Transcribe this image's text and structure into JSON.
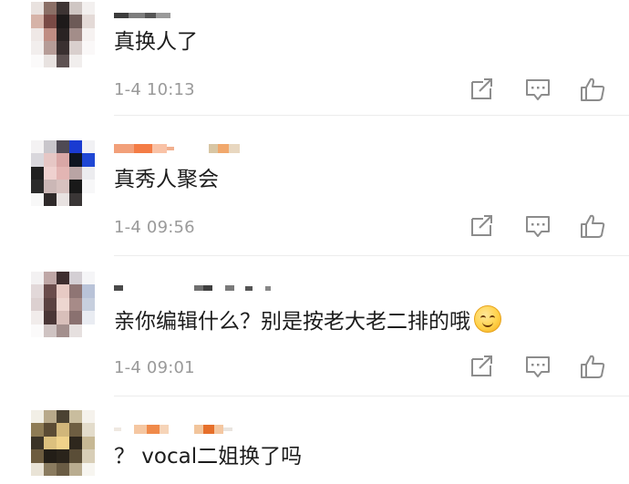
{
  "comments": [
    {
      "text": "真换人了",
      "time": "1-4 10:13"
    },
    {
      "text": "真秀人聚会",
      "time": "1-4 09:56"
    },
    {
      "text": "亲你编辑什么？别是按老大老二排的哦",
      "emoji": "smile-emoji",
      "time": "1-4 09:01"
    },
    {
      "text": "？ vocal二姐换了吗"
    }
  ],
  "icons": {
    "share": "share-icon",
    "comment": "comment-icon",
    "like": "like-icon"
  },
  "colors": {
    "text": "#1c1c1c",
    "time": "#9a9a9a",
    "icon": "#8c8c8c",
    "divider": "#ececec"
  }
}
